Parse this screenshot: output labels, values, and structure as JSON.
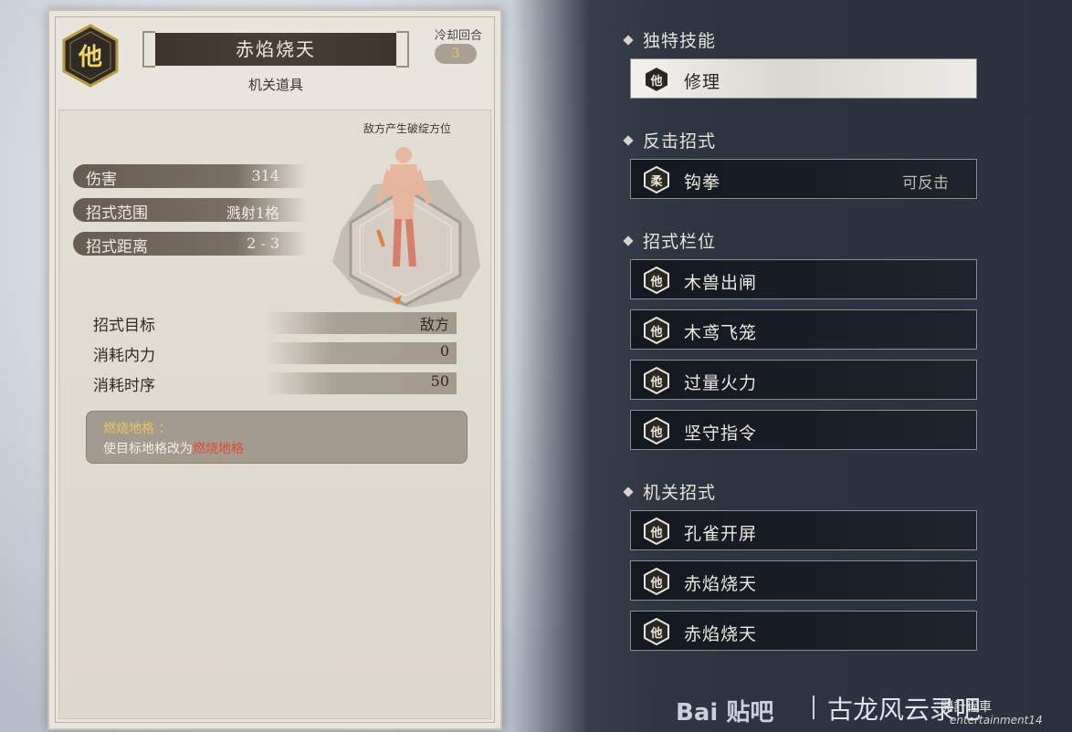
{
  "card": {
    "emblem_glyph": "他",
    "title": "赤焰烧天",
    "subtitle": "机关道具",
    "cooldown_label": "冷却回合",
    "cooldown_value": "3",
    "weakness_label": "敌方产生破绽方位",
    "stats": [
      {
        "label": "伤害",
        "value": "314"
      },
      {
        "label": "招式范围",
        "value": "溅射1格"
      },
      {
        "label": "招式距离",
        "value": "2 - 3"
      }
    ],
    "info": [
      {
        "label": "招式目标",
        "value": "敌方"
      },
      {
        "label": "消耗内力",
        "value": "0"
      },
      {
        "label": "消耗时序",
        "value": "50"
      }
    ],
    "effect": {
      "heading": "燃烧地格 ：",
      "prefix": "使目标地格改为",
      "highlight": "燃烧地格"
    }
  },
  "right": {
    "sections": [
      {
        "title": "独特技能"
      },
      {
        "title": "反击招式"
      },
      {
        "title": "招式栏位"
      },
      {
        "title": "机关招式"
      }
    ],
    "unique": [
      {
        "glyph": "他",
        "name": "修理"
      }
    ],
    "counter": [
      {
        "glyph": "柔",
        "name": "钩拳",
        "tag": "可反击"
      }
    ],
    "slots": [
      {
        "glyph": "他",
        "name": "木兽出闸"
      },
      {
        "glyph": "他",
        "name": "木鸢飞笼"
      },
      {
        "glyph": "他",
        "name": "过量火力"
      },
      {
        "glyph": "他",
        "name": "坚守指令"
      }
    ],
    "mechanism": [
      {
        "glyph": "他",
        "name": "孔雀开屏"
      },
      {
        "glyph": "他",
        "name": "赤焰烧天"
      },
      {
        "glyph": "他",
        "name": "赤焰烧天"
      }
    ]
  },
  "watermark": {
    "baidu": "Bai 贴吧",
    "forum": "古龙风云录吧",
    "sig": "開計程車",
    "sig2": "entertainment14"
  },
  "colors": {
    "highlight_yellow": "#e8c65c",
    "highlight_red": "#e0492f",
    "emblem_gold": "#f1d76a"
  }
}
